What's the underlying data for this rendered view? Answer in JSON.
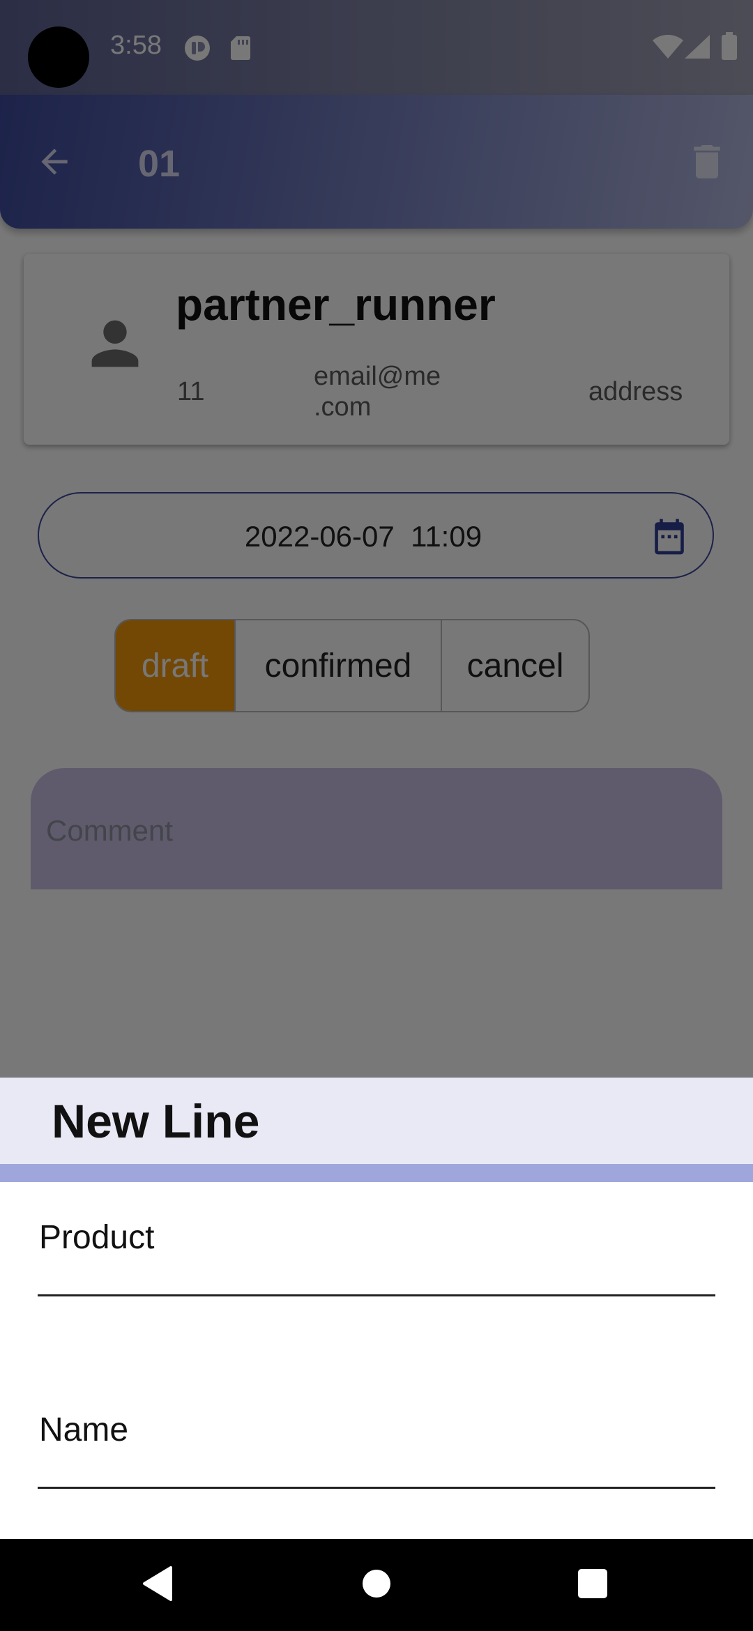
{
  "status_bar": {
    "time": "3:58",
    "icons": [
      "notification-app-icon",
      "sd-card-icon",
      "wifi-icon",
      "signal-icon",
      "battery-icon"
    ]
  },
  "app_bar": {
    "title": "01",
    "back_icon": "arrow-back-icon",
    "delete_icon": "trash-icon",
    "gradient": [
      "#3d4b9d",
      "#b3b8de"
    ]
  },
  "partner": {
    "name": "partner_runner",
    "phone": "11",
    "email": "email@me\n.com",
    "address": "address",
    "avatar_icon": "person-icon"
  },
  "date_field": {
    "value": "2022-06-07  11:09",
    "icon": "calendar-icon",
    "border_color": "#3d4a9a"
  },
  "state_toggle": {
    "options": [
      {
        "label": "draft",
        "selected": true
      },
      {
        "label": "confirmed",
        "selected": false
      },
      {
        "label": "cancel",
        "selected": false
      }
    ],
    "selected_color": "#f59a0c"
  },
  "comment": {
    "placeholder": "Comment",
    "fill_color": "#c9c2e6"
  },
  "bottom_sheet": {
    "title": "New Line",
    "fields": {
      "product_label": "Product",
      "name_label": "Name"
    },
    "header_color": "#e8e9f5",
    "divider_color": "#9ea6db"
  },
  "nav_bar": {
    "icons": [
      "nav-back-icon",
      "nav-home-icon",
      "nav-recents-icon"
    ]
  }
}
